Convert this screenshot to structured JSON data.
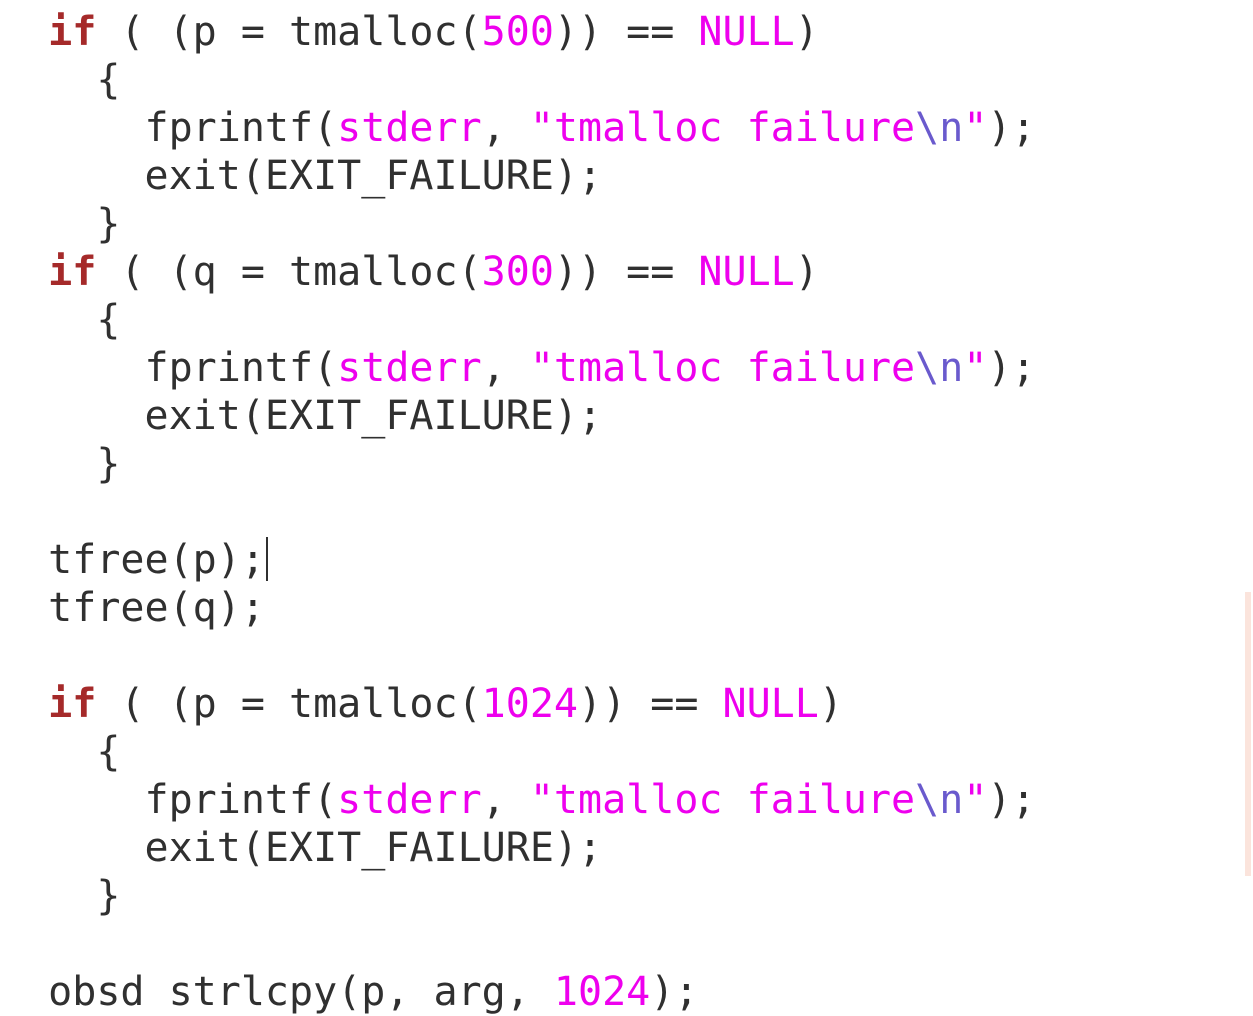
{
  "editor": {
    "lines": [
      [
        {
          "t": "if",
          "c": "kw",
          "i": 1
        },
        {
          "t": " ( (p = tmalloc("
        },
        {
          "t": "500",
          "c": "mag"
        },
        {
          "t": ")) == "
        },
        {
          "t": "NULL",
          "c": "mag"
        },
        {
          "t": ")"
        }
      ],
      [
        {
          "t": "{",
          "i": 2
        }
      ],
      [
        {
          "t": "fprintf(",
          "i": 3
        },
        {
          "t": "stderr",
          "c": "mag"
        },
        {
          "t": ", "
        },
        {
          "t": "\"tmalloc failure",
          "c": "mag"
        },
        {
          "t": "\\n",
          "c": "esc"
        },
        {
          "t": "\"",
          "c": "mag"
        },
        {
          "t": ");"
        }
      ],
      [
        {
          "t": "exit(EXIT_FAILURE);",
          "i": 3
        }
      ],
      [
        {
          "t": "}",
          "i": 2
        }
      ],
      [
        {
          "t": "if",
          "c": "kw",
          "i": 1
        },
        {
          "t": " ( (q = tmalloc("
        },
        {
          "t": "300",
          "c": "mag"
        },
        {
          "t": ")) == "
        },
        {
          "t": "NULL",
          "c": "mag"
        },
        {
          "t": ")"
        }
      ],
      [
        {
          "t": "{",
          "i": 2
        }
      ],
      [
        {
          "t": "fprintf(",
          "i": 3
        },
        {
          "t": "stderr",
          "c": "mag"
        },
        {
          "t": ", "
        },
        {
          "t": "\"tmalloc failure",
          "c": "mag"
        },
        {
          "t": "\\n",
          "c": "esc"
        },
        {
          "t": "\"",
          "c": "mag"
        },
        {
          "t": ");"
        }
      ],
      [
        {
          "t": "exit(EXIT_FAILURE);",
          "i": 3
        }
      ],
      [
        {
          "t": "}",
          "i": 2
        }
      ],
      [],
      [
        {
          "t": "tfree(p);",
          "i": 1,
          "caret": true
        }
      ],
      [
        {
          "t": "tfree(q);",
          "i": 1
        }
      ],
      [],
      [
        {
          "t": "if",
          "c": "kw",
          "i": 1
        },
        {
          "t": " ( (p = tmalloc("
        },
        {
          "t": "1024",
          "c": "mag"
        },
        {
          "t": ")) == "
        },
        {
          "t": "NULL",
          "c": "mag"
        },
        {
          "t": ")"
        }
      ],
      [
        {
          "t": "{",
          "i": 2
        }
      ],
      [
        {
          "t": "fprintf(",
          "i": 3
        },
        {
          "t": "stderr",
          "c": "mag"
        },
        {
          "t": ", "
        },
        {
          "t": "\"tmalloc failure",
          "c": "mag"
        },
        {
          "t": "\\n",
          "c": "esc"
        },
        {
          "t": "\"",
          "c": "mag"
        },
        {
          "t": ");"
        }
      ],
      [
        {
          "t": "exit(EXIT_FAILURE);",
          "i": 3
        }
      ],
      [
        {
          "t": "}",
          "i": 2
        }
      ],
      [],
      [
        {
          "t": "obsd strlcpy(p, arg, ",
          "i": 1
        },
        {
          "t": "1024",
          "c": "mag"
        },
        {
          "t": ");"
        }
      ]
    ]
  },
  "colors": {
    "keyword": "#a52a2a",
    "literal": "#ee00ee",
    "escape": "#6a5acd",
    "text": "#303030",
    "scroll_marker": "#fbe4dc"
  }
}
